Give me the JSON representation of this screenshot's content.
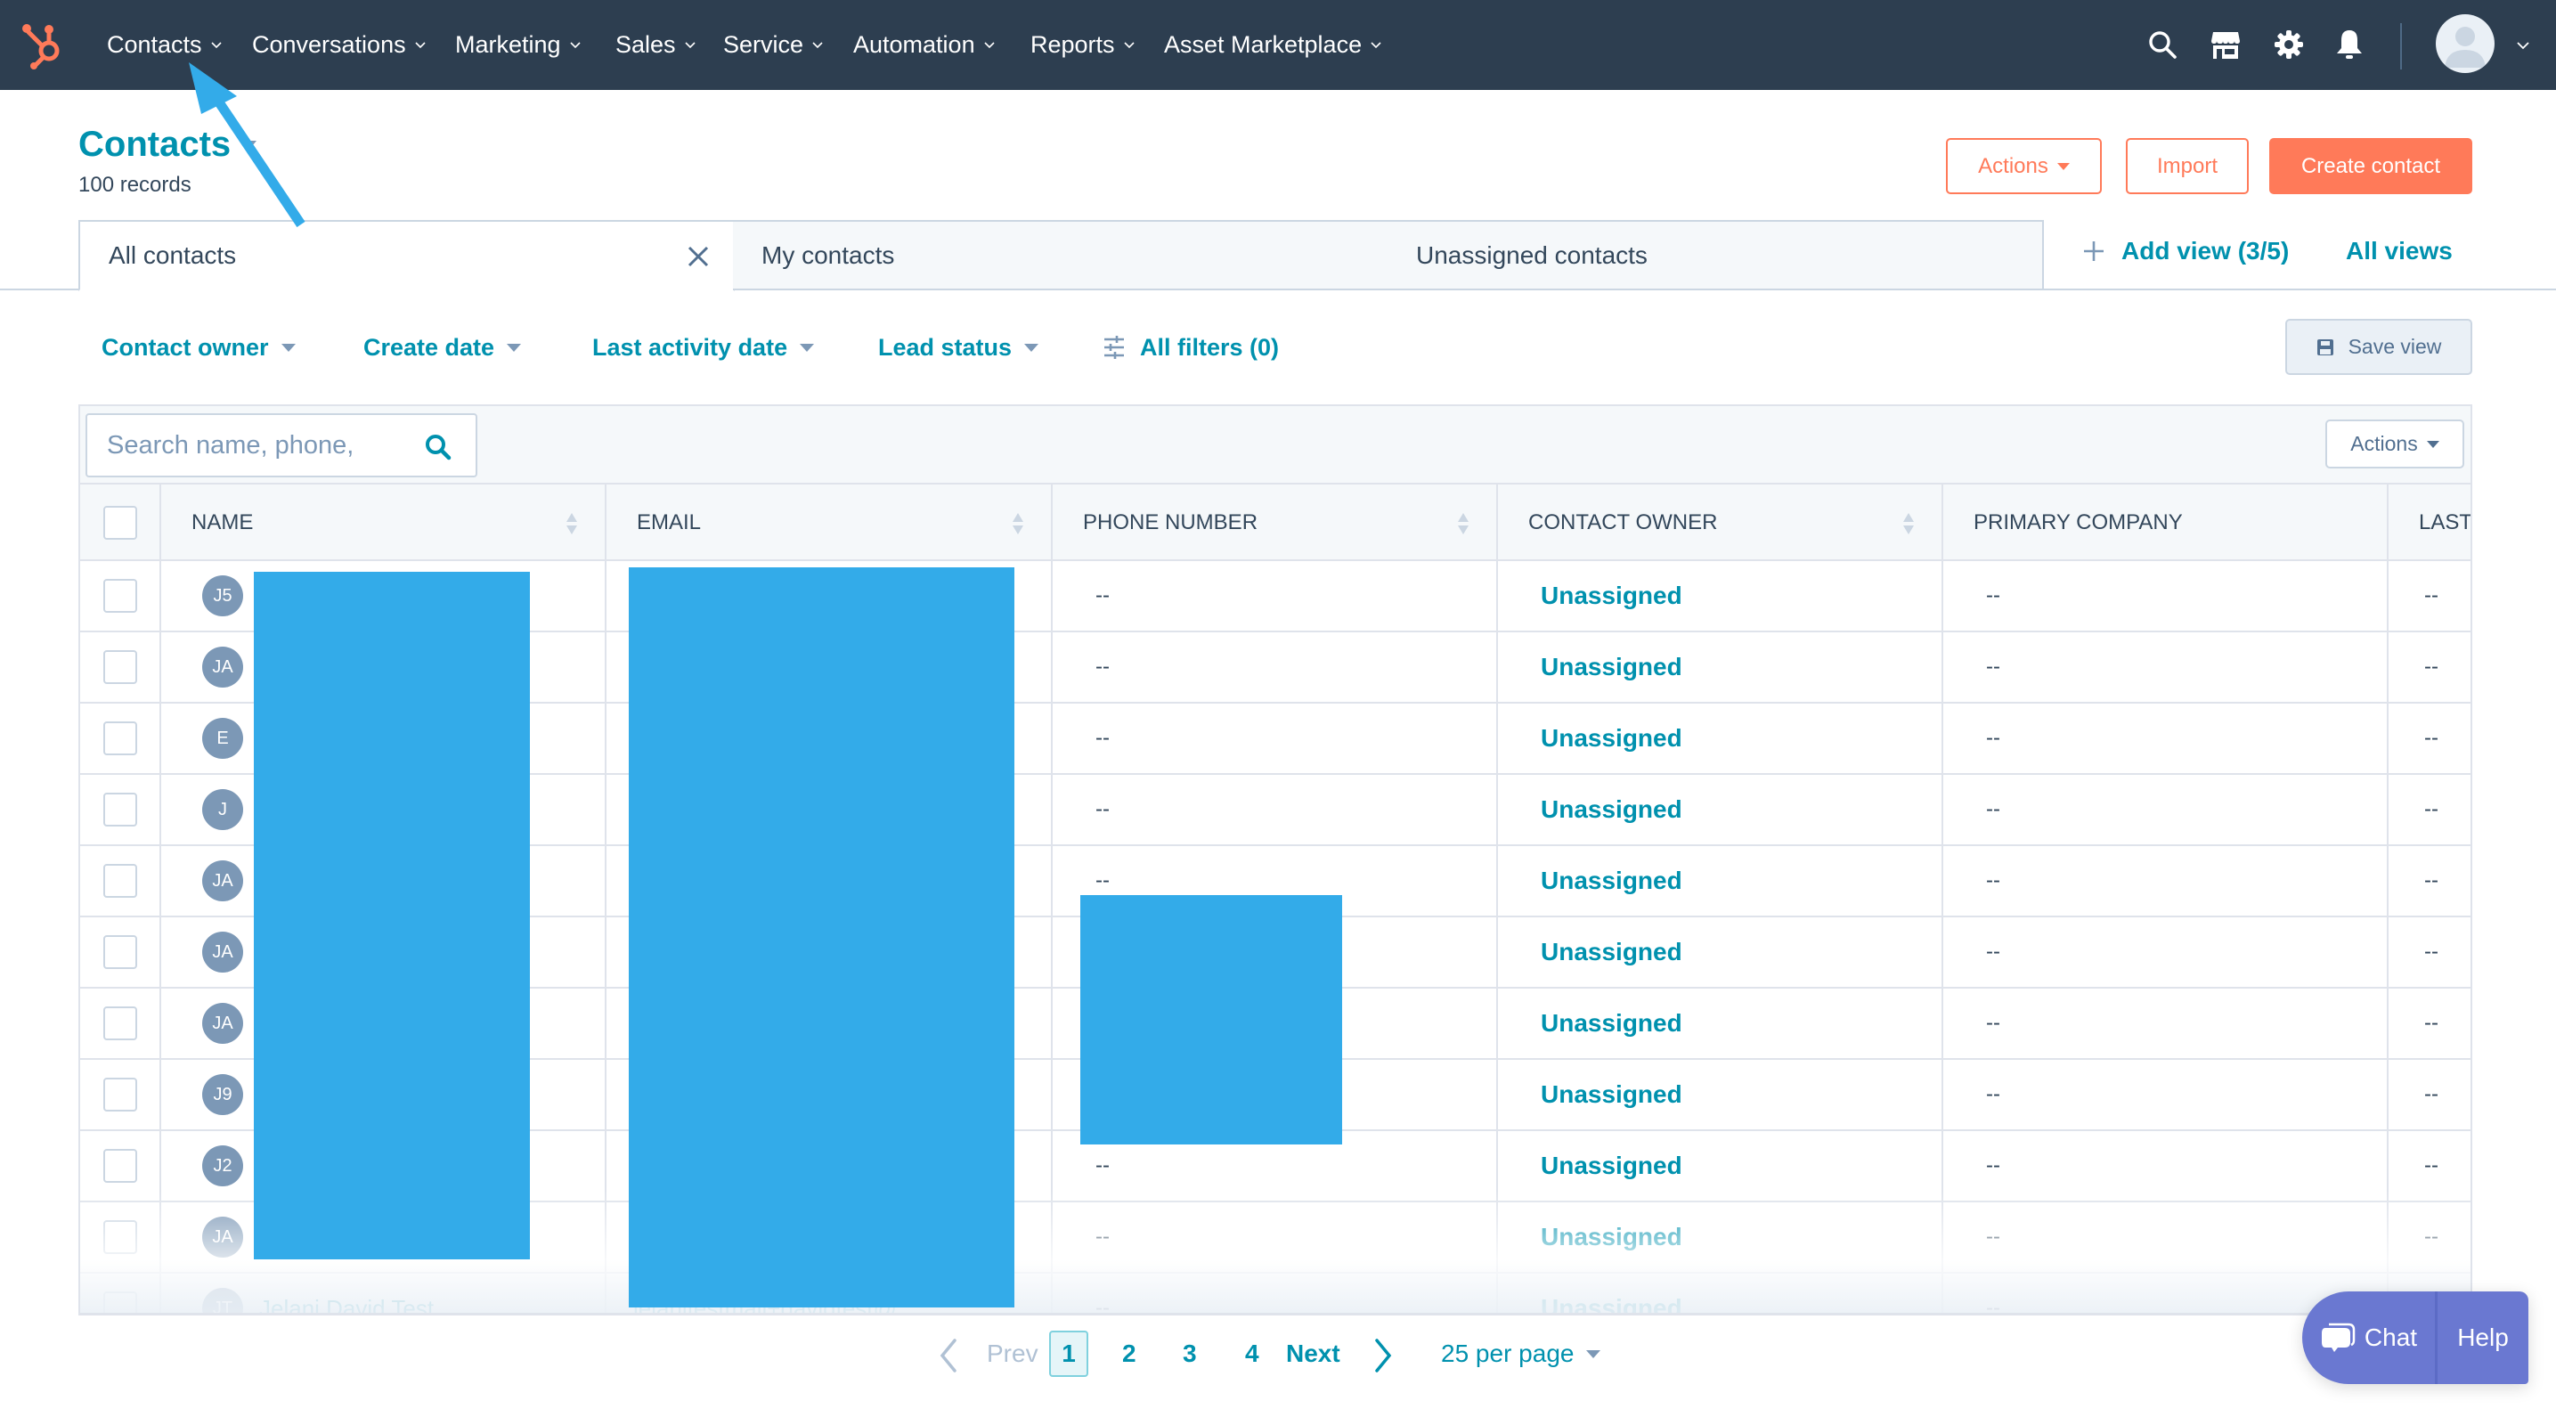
{
  "topnav": {
    "items": [
      {
        "label": "Contacts"
      },
      {
        "label": "Conversations"
      },
      {
        "label": "Marketing"
      },
      {
        "label": "Sales"
      },
      {
        "label": "Service"
      },
      {
        "label": "Automation"
      },
      {
        "label": "Reports"
      },
      {
        "label": "Asset Marketplace"
      }
    ],
    "icons": [
      "search-icon",
      "marketplace-icon",
      "settings-icon",
      "notifications-icon"
    ]
  },
  "header": {
    "title": "Contacts",
    "record_count": "100 records",
    "actions_label": "Actions",
    "import_label": "Import",
    "create_label": "Create contact"
  },
  "views": {
    "tabs": [
      {
        "label": "All contacts",
        "active": true
      },
      {
        "label": "My contacts",
        "active": false
      },
      {
        "label": "Unassigned contacts",
        "active": false
      }
    ],
    "add_view_label": "Add view (3/5)",
    "all_views_label": "All views"
  },
  "filters": {
    "items": [
      {
        "label": "Contact owner"
      },
      {
        "label": "Create date"
      },
      {
        "label": "Last activity date"
      },
      {
        "label": "Lead status"
      }
    ],
    "all_filters_label": "All filters (0)",
    "save_view_label": "Save view"
  },
  "table": {
    "search_placeholder": "Search name, phone,",
    "actions_label": "Actions",
    "columns": [
      "NAME",
      "EMAIL",
      "PHONE NUMBER",
      "CONTACT OWNER",
      "PRIMARY COMPANY",
      "LAST"
    ],
    "rows": [
      {
        "initials": "J5",
        "name": "",
        "email": "",
        "phone": "--",
        "owner": "Unassigned",
        "company": "--",
        "last": "--"
      },
      {
        "initials": "JA",
        "name": "",
        "email": "",
        "phone": "--",
        "owner": "Unassigned",
        "company": "--",
        "last": "--"
      },
      {
        "initials": "E",
        "name": "",
        "email": "",
        "phone": "--",
        "owner": "Unassigned",
        "company": "--",
        "last": "--"
      },
      {
        "initials": "J",
        "name": "",
        "email": "",
        "phone": "--",
        "owner": "Unassigned",
        "company": "--",
        "last": "--"
      },
      {
        "initials": "JA",
        "name": "",
        "email": "",
        "phone": "--",
        "owner": "Unassigned",
        "company": "--",
        "last": "--"
      },
      {
        "initials": "JA",
        "name": "",
        "email": "",
        "phone": "",
        "owner": "Unassigned",
        "company": "--",
        "last": "--"
      },
      {
        "initials": "JA",
        "name": "",
        "email": "",
        "phone": "",
        "owner": "Unassigned",
        "company": "--",
        "last": "--"
      },
      {
        "initials": "J9",
        "name": "",
        "email": "",
        "phone": "",
        "owner": "Unassigned",
        "company": "--",
        "last": "--"
      },
      {
        "initials": "J2",
        "name": "",
        "email": "",
        "phone": "--",
        "owner": "Unassigned",
        "company": "--",
        "last": "--"
      },
      {
        "initials": "JA",
        "name": "",
        "email": "",
        "phone": "--",
        "owner": "Unassigned",
        "company": "--",
        "last": "--"
      },
      {
        "initials": "JT",
        "name": "Jelani David Test",
        "email": "jelanitestmail+davidtest@",
        "phone": "--",
        "owner": "Unassigned",
        "company": "--",
        "last": "--"
      }
    ]
  },
  "pagination": {
    "prev_label": "Prev",
    "pages": [
      "1",
      "2",
      "3",
      "4"
    ],
    "current_page": "1",
    "next_label": "Next",
    "page_size_label": "25 per page"
  },
  "chat_widget": {
    "chat_label": "Chat",
    "help_label": "Help"
  },
  "colors": {
    "nav_bg": "#2d3e50",
    "accent_teal": "#0091ae",
    "brand_orange": "#ff7a59",
    "chat_purple": "#6a78d1",
    "redaction_blue": "#33abe9"
  }
}
